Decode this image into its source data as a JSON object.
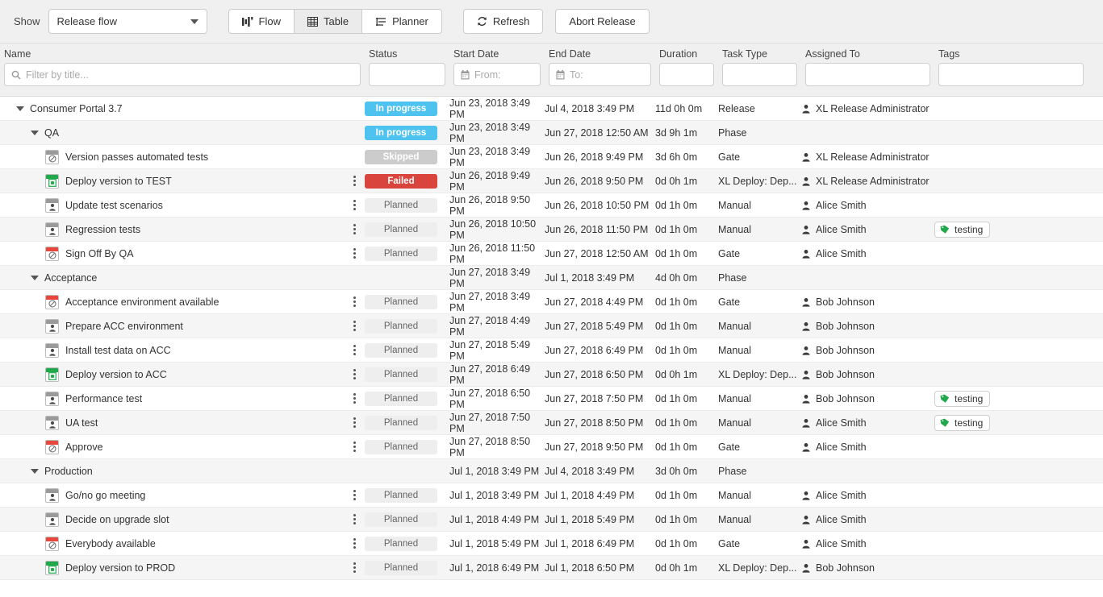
{
  "toolbar": {
    "show_label": "Show",
    "select_value": "Release flow",
    "views": [
      {
        "label": "Flow",
        "icon": "flow-icon",
        "active": false
      },
      {
        "label": "Table",
        "icon": "table-icon",
        "active": true
      },
      {
        "label": "Planner",
        "icon": "planner-icon",
        "active": false
      }
    ],
    "refresh_label": "Refresh",
    "abort_label": "Abort Release"
  },
  "columns": [
    {
      "key": "name",
      "label": "Name",
      "filter_placeholder": "Filter by title...",
      "filter_value": "",
      "icon": "search-icon"
    },
    {
      "key": "status",
      "label": "Status",
      "filter_placeholder": "",
      "filter_value": "",
      "icon": ""
    },
    {
      "key": "start",
      "label": "Start Date",
      "filter_placeholder": "From:",
      "filter_value": "",
      "icon": "calendar-icon"
    },
    {
      "key": "end",
      "label": "End Date",
      "filter_placeholder": "To:",
      "filter_value": "",
      "icon": "calendar-icon"
    },
    {
      "key": "duration",
      "label": "Duration",
      "filter_placeholder": "",
      "filter_value": "",
      "icon": ""
    },
    {
      "key": "type",
      "label": "Task Type",
      "filter_placeholder": "",
      "filter_value": "",
      "icon": ""
    },
    {
      "key": "assigned",
      "label": "Assigned To",
      "filter_placeholder": "",
      "filter_value": "",
      "icon": ""
    },
    {
      "key": "tags",
      "label": "Tags",
      "filter_placeholder": "",
      "filter_value": "",
      "icon": ""
    }
  ],
  "colors": {
    "in_progress": "#4fc3f0",
    "failed": "#d9453c",
    "skipped": "#cccccc",
    "planned": "#eeeeee",
    "tag_green": "#21a84b",
    "gate_red": "#e8453c",
    "deploy_green": "#21a84b",
    "manual_gray": "#9a9a9a"
  },
  "rows": [
    {
      "indent": 0,
      "twisty": true,
      "icon": "",
      "icon_bar": "",
      "name": "Consumer Portal 3.7",
      "status": "In progress",
      "status_kind": "inprogress",
      "start": "Jun 23, 2018 3:49 PM",
      "end": "Jul 4, 2018 3:49 PM",
      "duration": "11d 0h 0m",
      "type": "Release",
      "assigned": "XL Release Administrator",
      "tags": "",
      "menu": false
    },
    {
      "indent": 1,
      "twisty": true,
      "icon": "",
      "icon_bar": "",
      "name": "QA",
      "status": "In progress",
      "status_kind": "inprogress",
      "start": "Jun 23, 2018 3:49 PM",
      "end": "Jun 27, 2018 12:50 AM",
      "duration": "3d 9h 1m",
      "type": "Phase",
      "assigned": "",
      "tags": "",
      "menu": false
    },
    {
      "indent": 2,
      "twisty": false,
      "icon": "gate-icon",
      "icon_bar": "gray",
      "name": "Version passes automated tests",
      "status": "Skipped",
      "status_kind": "skipped",
      "start": "Jun 23, 2018 3:49 PM",
      "end": "Jun 26, 2018 9:49 PM",
      "duration": "3d 6h 0m",
      "type": "Gate",
      "assigned": "XL Release Administrator",
      "tags": "",
      "menu": false
    },
    {
      "indent": 2,
      "twisty": false,
      "icon": "deploy-icon",
      "icon_bar": "green",
      "name": "Deploy version to TEST",
      "status": "Failed",
      "status_kind": "failed",
      "start": "Jun 26, 2018 9:49 PM",
      "end": "Jun 26, 2018 9:50 PM",
      "duration": "0d 0h 1m",
      "type": "XL Deploy: Dep...",
      "assigned": "XL Release Administrator",
      "tags": "",
      "menu": true
    },
    {
      "indent": 2,
      "twisty": false,
      "icon": "manual-icon",
      "icon_bar": "gray",
      "name": "Update test scenarios",
      "status": "Planned",
      "status_kind": "planned",
      "start": "Jun 26, 2018 9:50 PM",
      "end": "Jun 26, 2018 10:50 PM",
      "duration": "0d 1h 0m",
      "type": "Manual",
      "assigned": "Alice Smith",
      "tags": "",
      "menu": true
    },
    {
      "indent": 2,
      "twisty": false,
      "icon": "manual-icon",
      "icon_bar": "gray",
      "name": "Regression tests",
      "status": "Planned",
      "status_kind": "planned",
      "start": "Jun 26, 2018 10:50 PM",
      "end": "Jun 26, 2018 11:50 PM",
      "duration": "0d 1h 0m",
      "type": "Manual",
      "assigned": "Alice Smith",
      "tags": "testing",
      "menu": true
    },
    {
      "indent": 2,
      "twisty": false,
      "icon": "gate-icon",
      "icon_bar": "red",
      "name": "Sign Off By QA",
      "status": "Planned",
      "status_kind": "planned",
      "start": "Jun 26, 2018 11:50 PM",
      "end": "Jun 27, 2018 12:50 AM",
      "duration": "0d 1h 0m",
      "type": "Gate",
      "assigned": "Alice Smith",
      "tags": "",
      "menu": true
    },
    {
      "indent": 1,
      "twisty": true,
      "icon": "",
      "icon_bar": "",
      "name": "Acceptance",
      "status": "",
      "status_kind": "none",
      "start": "Jun 27, 2018 3:49 PM",
      "end": "Jul 1, 2018 3:49 PM",
      "duration": "4d 0h 0m",
      "type": "Phase",
      "assigned": "",
      "tags": "",
      "menu": false
    },
    {
      "indent": 2,
      "twisty": false,
      "icon": "gate-icon",
      "icon_bar": "red",
      "name": "Acceptance environment available",
      "status": "Planned",
      "status_kind": "planned",
      "start": "Jun 27, 2018 3:49 PM",
      "end": "Jun 27, 2018 4:49 PM",
      "duration": "0d 1h 0m",
      "type": "Gate",
      "assigned": "Bob Johnson",
      "tags": "",
      "menu": true
    },
    {
      "indent": 2,
      "twisty": false,
      "icon": "manual-icon",
      "icon_bar": "gray",
      "name": "Prepare ACC environment",
      "status": "Planned",
      "status_kind": "planned",
      "start": "Jun 27, 2018 4:49 PM",
      "end": "Jun 27, 2018 5:49 PM",
      "duration": "0d 1h 0m",
      "type": "Manual",
      "assigned": "Bob Johnson",
      "tags": "",
      "menu": true
    },
    {
      "indent": 2,
      "twisty": false,
      "icon": "manual-icon",
      "icon_bar": "gray",
      "name": "Install test data on ACC",
      "status": "Planned",
      "status_kind": "planned",
      "start": "Jun 27, 2018 5:49 PM",
      "end": "Jun 27, 2018 6:49 PM",
      "duration": "0d 1h 0m",
      "type": "Manual",
      "assigned": "Bob Johnson",
      "tags": "",
      "menu": true
    },
    {
      "indent": 2,
      "twisty": false,
      "icon": "deploy-icon",
      "icon_bar": "green",
      "name": "Deploy version to ACC",
      "status": "Planned",
      "status_kind": "planned",
      "start": "Jun 27, 2018 6:49 PM",
      "end": "Jun 27, 2018 6:50 PM",
      "duration": "0d 0h 1m",
      "type": "XL Deploy: Dep...",
      "assigned": "Bob Johnson",
      "tags": "",
      "menu": true
    },
    {
      "indent": 2,
      "twisty": false,
      "icon": "manual-icon",
      "icon_bar": "gray",
      "name": "Performance test",
      "status": "Planned",
      "status_kind": "planned",
      "start": "Jun 27, 2018 6:50 PM",
      "end": "Jun 27, 2018 7:50 PM",
      "duration": "0d 1h 0m",
      "type": "Manual",
      "assigned": "Bob Johnson",
      "tags": "testing",
      "menu": true
    },
    {
      "indent": 2,
      "twisty": false,
      "icon": "manual-icon",
      "icon_bar": "gray",
      "name": "UA test",
      "status": "Planned",
      "status_kind": "planned",
      "start": "Jun 27, 2018 7:50 PM",
      "end": "Jun 27, 2018 8:50 PM",
      "duration": "0d 1h 0m",
      "type": "Manual",
      "assigned": "Alice Smith",
      "tags": "testing",
      "menu": true
    },
    {
      "indent": 2,
      "twisty": false,
      "icon": "gate-icon",
      "icon_bar": "red",
      "name": "Approve",
      "status": "Planned",
      "status_kind": "planned",
      "start": "Jun 27, 2018 8:50 PM",
      "end": "Jun 27, 2018 9:50 PM",
      "duration": "0d 1h 0m",
      "type": "Gate",
      "assigned": "Alice Smith",
      "tags": "",
      "menu": true
    },
    {
      "indent": 1,
      "twisty": true,
      "icon": "",
      "icon_bar": "",
      "name": "Production",
      "status": "",
      "status_kind": "none",
      "start": "Jul 1, 2018 3:49 PM",
      "end": "Jul 4, 2018 3:49 PM",
      "duration": "3d 0h 0m",
      "type": "Phase",
      "assigned": "",
      "tags": "",
      "menu": false
    },
    {
      "indent": 2,
      "twisty": false,
      "icon": "manual-icon",
      "icon_bar": "gray",
      "name": "Go/no go meeting",
      "status": "Planned",
      "status_kind": "planned",
      "start": "Jul 1, 2018 3:49 PM",
      "end": "Jul 1, 2018 4:49 PM",
      "duration": "0d 1h 0m",
      "type": "Manual",
      "assigned": "Alice Smith",
      "tags": "",
      "menu": true
    },
    {
      "indent": 2,
      "twisty": false,
      "icon": "manual-icon",
      "icon_bar": "gray",
      "name": "Decide on upgrade slot",
      "status": "Planned",
      "status_kind": "planned",
      "start": "Jul 1, 2018 4:49 PM",
      "end": "Jul 1, 2018 5:49 PM",
      "duration": "0d 1h 0m",
      "type": "Manual",
      "assigned": "Alice Smith",
      "tags": "",
      "menu": true
    },
    {
      "indent": 2,
      "twisty": false,
      "icon": "gate-icon",
      "icon_bar": "red",
      "name": "Everybody available",
      "status": "Planned",
      "status_kind": "planned",
      "start": "Jul 1, 2018 5:49 PM",
      "end": "Jul 1, 2018 6:49 PM",
      "duration": "0d 1h 0m",
      "type": "Gate",
      "assigned": "Alice Smith",
      "tags": "",
      "menu": true
    },
    {
      "indent": 2,
      "twisty": false,
      "icon": "deploy-icon",
      "icon_bar": "green",
      "name": "Deploy version to PROD",
      "status": "Planned",
      "status_kind": "planned",
      "start": "Jul 1, 2018 6:49 PM",
      "end": "Jul 1, 2018 6:50 PM",
      "duration": "0d 0h 1m",
      "type": "XL Deploy: Dep...",
      "assigned": "Bob Johnson",
      "tags": "",
      "menu": true
    }
  ]
}
